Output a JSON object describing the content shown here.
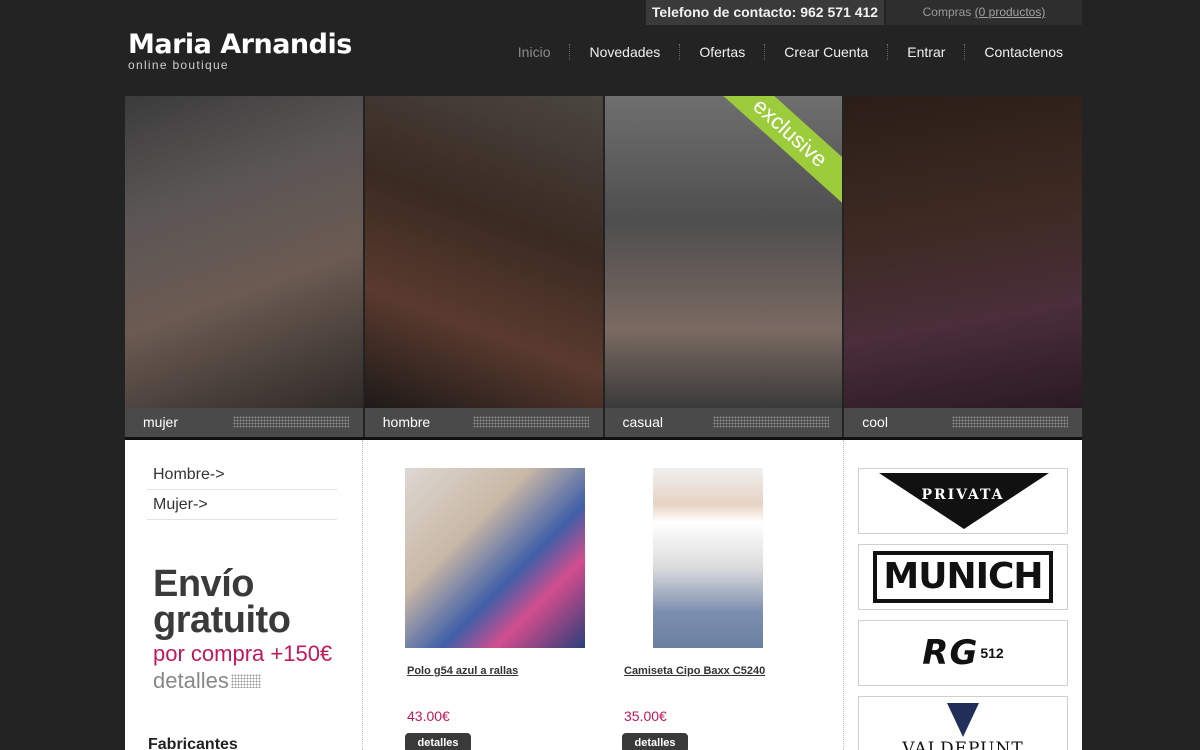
{
  "topbar": {
    "phone": "Telefono de contacto: 962 571 412",
    "cart_prefix": "Compras",
    "cart_link": "(0 productos)"
  },
  "logo": {
    "title": "Maria Arnandis",
    "subtitle": "online boutique"
  },
  "nav": {
    "items": [
      {
        "label": "Inicio",
        "active": true
      },
      {
        "label": "Novedades"
      },
      {
        "label": "Ofertas"
      },
      {
        "label": "Crear Cuenta"
      },
      {
        "label": "Entrar"
      },
      {
        "label": "Contactenos"
      }
    ]
  },
  "banner": {
    "panels": [
      {
        "label": "mujer"
      },
      {
        "label": "hombre"
      },
      {
        "label": "casual",
        "sash": "exclusive"
      },
      {
        "label": "cool"
      }
    ]
  },
  "sidebar": {
    "menu": [
      "Hombre->",
      "Mujer->"
    ],
    "promo": {
      "line1": "Envío",
      "line2": "gratuito",
      "line3": "por compra +150€",
      "line4": "detalles"
    },
    "heading": "Fabricantes"
  },
  "products": [
    {
      "name": "Polo g54 azul a rallas",
      "price": "43.00€",
      "button": "detalles"
    },
    {
      "name": "Camiseta Cipo Baxx C5240",
      "price": "35.00€",
      "button": "detalles"
    }
  ],
  "brands": [
    {
      "name": "PRIVATA"
    },
    {
      "name": "MUNICH"
    },
    {
      "name": "RG",
      "suffix": "512"
    },
    {
      "name": "VALDEPUNT"
    }
  ],
  "colors": {
    "accent": "#c2185b",
    "sash": "#9ccc3c",
    "background": "#232323"
  }
}
